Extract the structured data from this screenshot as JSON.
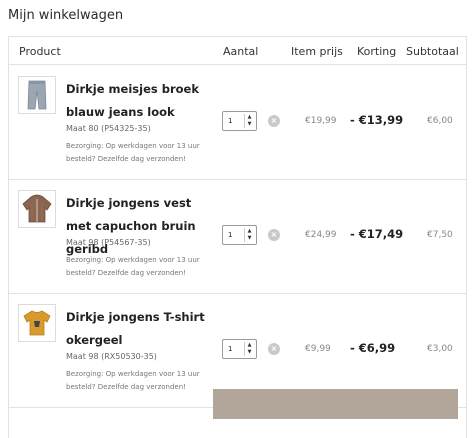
{
  "page": {
    "title": "Mijn winkelwagen"
  },
  "table": {
    "headers": {
      "product": "Product",
      "qty": "Aantal",
      "price": "Item prijs",
      "discount": "Korting",
      "subtotal": "Subtotaal"
    }
  },
  "items": [
    {
      "name": "Dirkje meisjes broek blauw jeans look",
      "size": "Maat 80 (P54325-35)",
      "delivery": "Bezorging: Op werkdagen voor 13 uur besteld? Dezelfde dag verzonden!",
      "qty": "1",
      "price": "€19,99",
      "discount": "- €13,99",
      "subtotal": "€6,00",
      "thumb_icon": "jeans-icon"
    },
    {
      "name": "Dirkje jongens vest met capuchon bruin geribd",
      "size": "Maat 98 (P54567-35)",
      "delivery": "Bezorging: Op werkdagen voor 13 uur besteld? Dezelfde dag verzonden!",
      "qty": "1",
      "price": "€24,99",
      "discount": "- €17,49",
      "subtotal": "€7,50",
      "thumb_icon": "hoodie-icon"
    },
    {
      "name": "Dirkje jongens T-shirt okergeel",
      "size": "Maat 98 (RX50530-35)",
      "delivery": "Bezorging: Op werkdagen voor 13 uur besteld? Dezelfde dag verzonden!",
      "qty": "1",
      "price": "€9,99",
      "discount": "- €6,99",
      "subtotal": "€3,00",
      "thumb_icon": "tshirt-icon"
    }
  ],
  "colors": {
    "accent_button": "#b2a69a",
    "border": "#e2e2e2"
  }
}
